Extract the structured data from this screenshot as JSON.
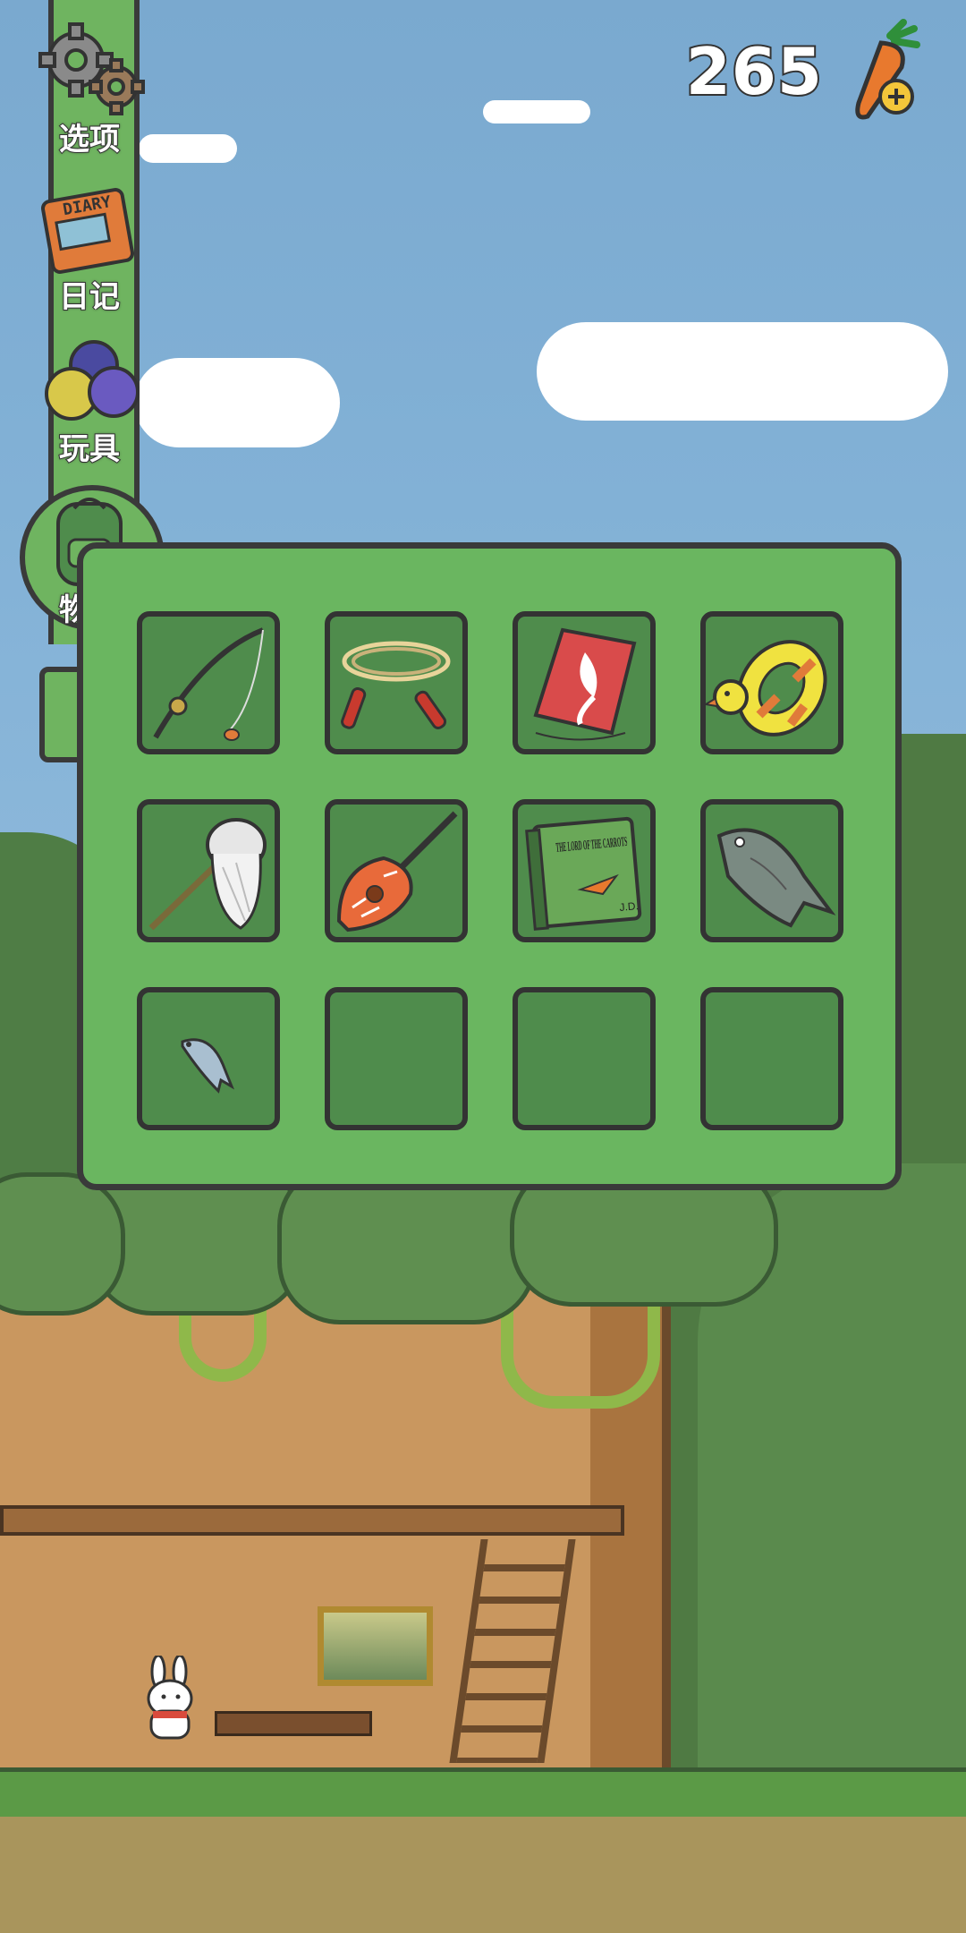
{
  "side_menu": {
    "items": [
      {
        "key": "options",
        "label": "选项",
        "icon": "gears-icon"
      },
      {
        "key": "diary",
        "label": "日记",
        "icon": "diary-book-icon",
        "icon_text": "DIARY"
      },
      {
        "key": "toys",
        "label": "玩具",
        "icon": "balls-icon"
      },
      {
        "key": "items",
        "label": "物品",
        "icon": "backpack-icon",
        "active": true
      }
    ]
  },
  "currency": {
    "amount": "265",
    "icon": "carrot-plus-icon"
  },
  "inventory": {
    "slots": [
      {
        "item": "fishing-rod"
      },
      {
        "item": "jump-rope"
      },
      {
        "item": "kite"
      },
      {
        "item": "duck-swim-ring"
      },
      {
        "item": "bug-net"
      },
      {
        "item": "carrot-ukulele"
      },
      {
        "item": "book",
        "book_title": "THE LORD OF THE CARROTS",
        "book_author": "J.D."
      },
      {
        "item": "big-fish"
      },
      {
        "item": "small-fish"
      },
      {
        "item": null
      },
      {
        "item": null
      },
      {
        "item": null
      }
    ]
  },
  "colors": {
    "panel": "#6ab660",
    "slot": "#4f8c4c",
    "outline": "#333333",
    "sky": "#82b1d6"
  }
}
